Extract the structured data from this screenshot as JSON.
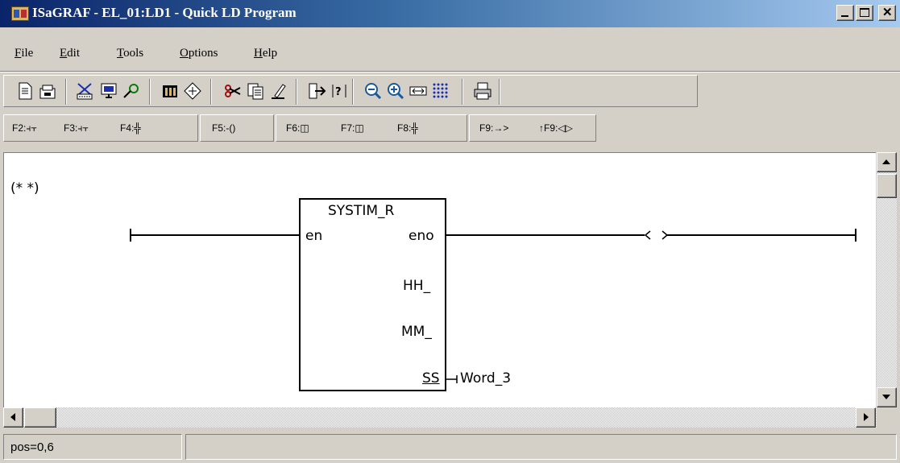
{
  "window": {
    "title": "ISaGRAF - EL_01:LD1 - Quick LD Program",
    "icon": "isagraf-app-icon",
    "controls": [
      "minimize-icon",
      "maximize-icon",
      "close-icon"
    ]
  },
  "menu": [
    "File",
    "Edit",
    "Tools",
    "Options",
    "Help"
  ],
  "toolbar": {
    "icons": [
      "new-icon",
      "open-icon",
      "cut-icon",
      "monitor-icon",
      "find-icon",
      "library-icon",
      "variables-icon",
      "scissors-icon",
      "copy-icon",
      "erase-icon",
      "exit-icon",
      "help-icon",
      "zoom-out-icon",
      "zoom-in-icon",
      "width-icon",
      "grid-icon",
      "print-icon"
    ]
  },
  "function_keys": {
    "f2": "F2:",
    "f3": "F3:",
    "f4": "F4:",
    "f5": "F5:",
    "f6": "F6:",
    "f7": "F7:",
    "f8": "F8:",
    "f9": "F9:",
    "sf9": "↑F9:"
  },
  "diagram": {
    "comment": "(* *)",
    "block_name": "SYSTIM_R",
    "pin_en": "en",
    "pin_eno": "eno",
    "pin_hh": "HH_",
    "pin_mm": "MM_",
    "pin_ss": "SS",
    "ss_output": "Word_3",
    "coil": "< >"
  },
  "status": {
    "position": "pos=0,6"
  },
  "colors": {
    "title_start": "#0a246a",
    "title_end": "#a6caf0",
    "face": "#d4d0c8"
  }
}
